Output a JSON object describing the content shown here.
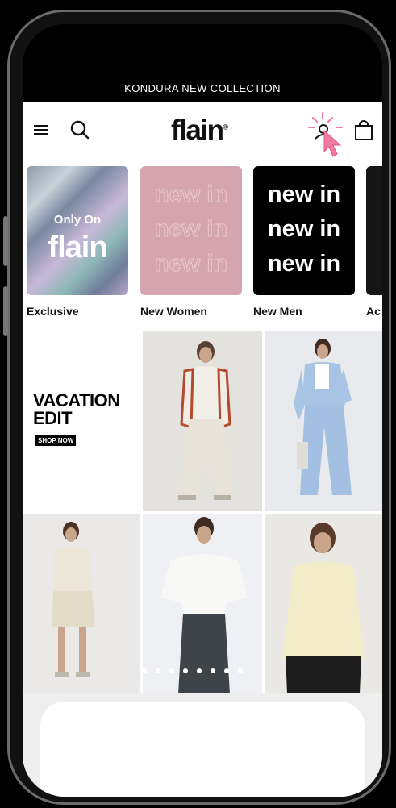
{
  "announcement": "KONDURA NEW COLLECTION",
  "header": {
    "logo": "flain",
    "logo_mark": "®",
    "icons": [
      "menu-icon",
      "search-icon",
      "user-icon",
      "shopping-bag-icon"
    ]
  },
  "stories": [
    {
      "label": "Exclusive",
      "line1": "Only On",
      "line2": "flain"
    },
    {
      "label": "New Women",
      "lines": [
        "new in",
        "new in",
        "new in"
      ]
    },
    {
      "label": "New Men",
      "lines": [
        "new in",
        "new in",
        "new in"
      ]
    },
    {
      "label": "Ac"
    }
  ],
  "promo": {
    "title_line1": "VACATION",
    "title_line2": "EDIT",
    "cta": "SHOP NOW"
  },
  "colors": {
    "accent_cursor": "#f07aa0",
    "background": "#ffffff",
    "dark": "#000000"
  }
}
